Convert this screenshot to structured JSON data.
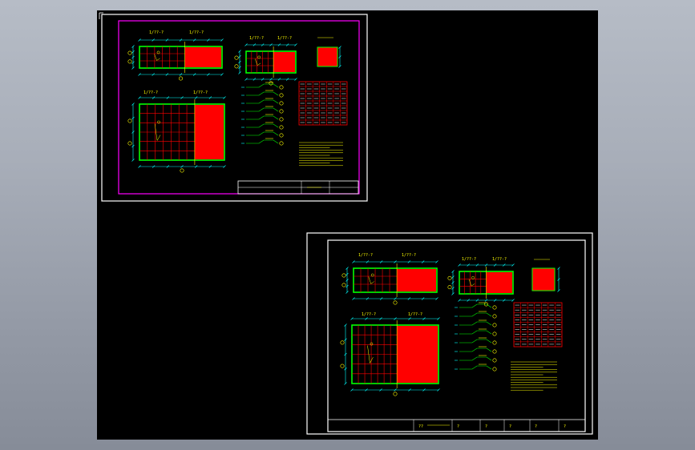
{
  "colors": {
    "canvas_bg": "#000000",
    "app_bg": "#a8aeb9",
    "sheet_frame": "#ffffff",
    "magenta_frame": "#ff00ff",
    "fill": "#ff0000",
    "wall": "#00ff00",
    "dimension": "#00ffff",
    "text": "#ffff00"
  },
  "icons": {
    "ucs": "ucs-icon"
  },
  "drawing": {
    "sheet_a": {
      "plan_top_titles": [
        "1/??-?",
        "1/??-?"
      ],
      "plan_mid_titles": [
        "1/??-?",
        "1/??-?"
      ],
      "plan_big_titles": [
        "1/??-?",
        "1/??-?"
      ]
    },
    "sheet_b": {
      "plan_top_titles": [
        "1/??-?",
        "1/??-?"
      ],
      "plan_mid_titles": [
        "1/??-?",
        "1/??-?"
      ],
      "plan_big_titles": [
        "1/??-?",
        "1/??-?"
      ],
      "title_block_cells": [
        "??",
        "?",
        "?",
        "?",
        "?",
        "?"
      ]
    }
  }
}
